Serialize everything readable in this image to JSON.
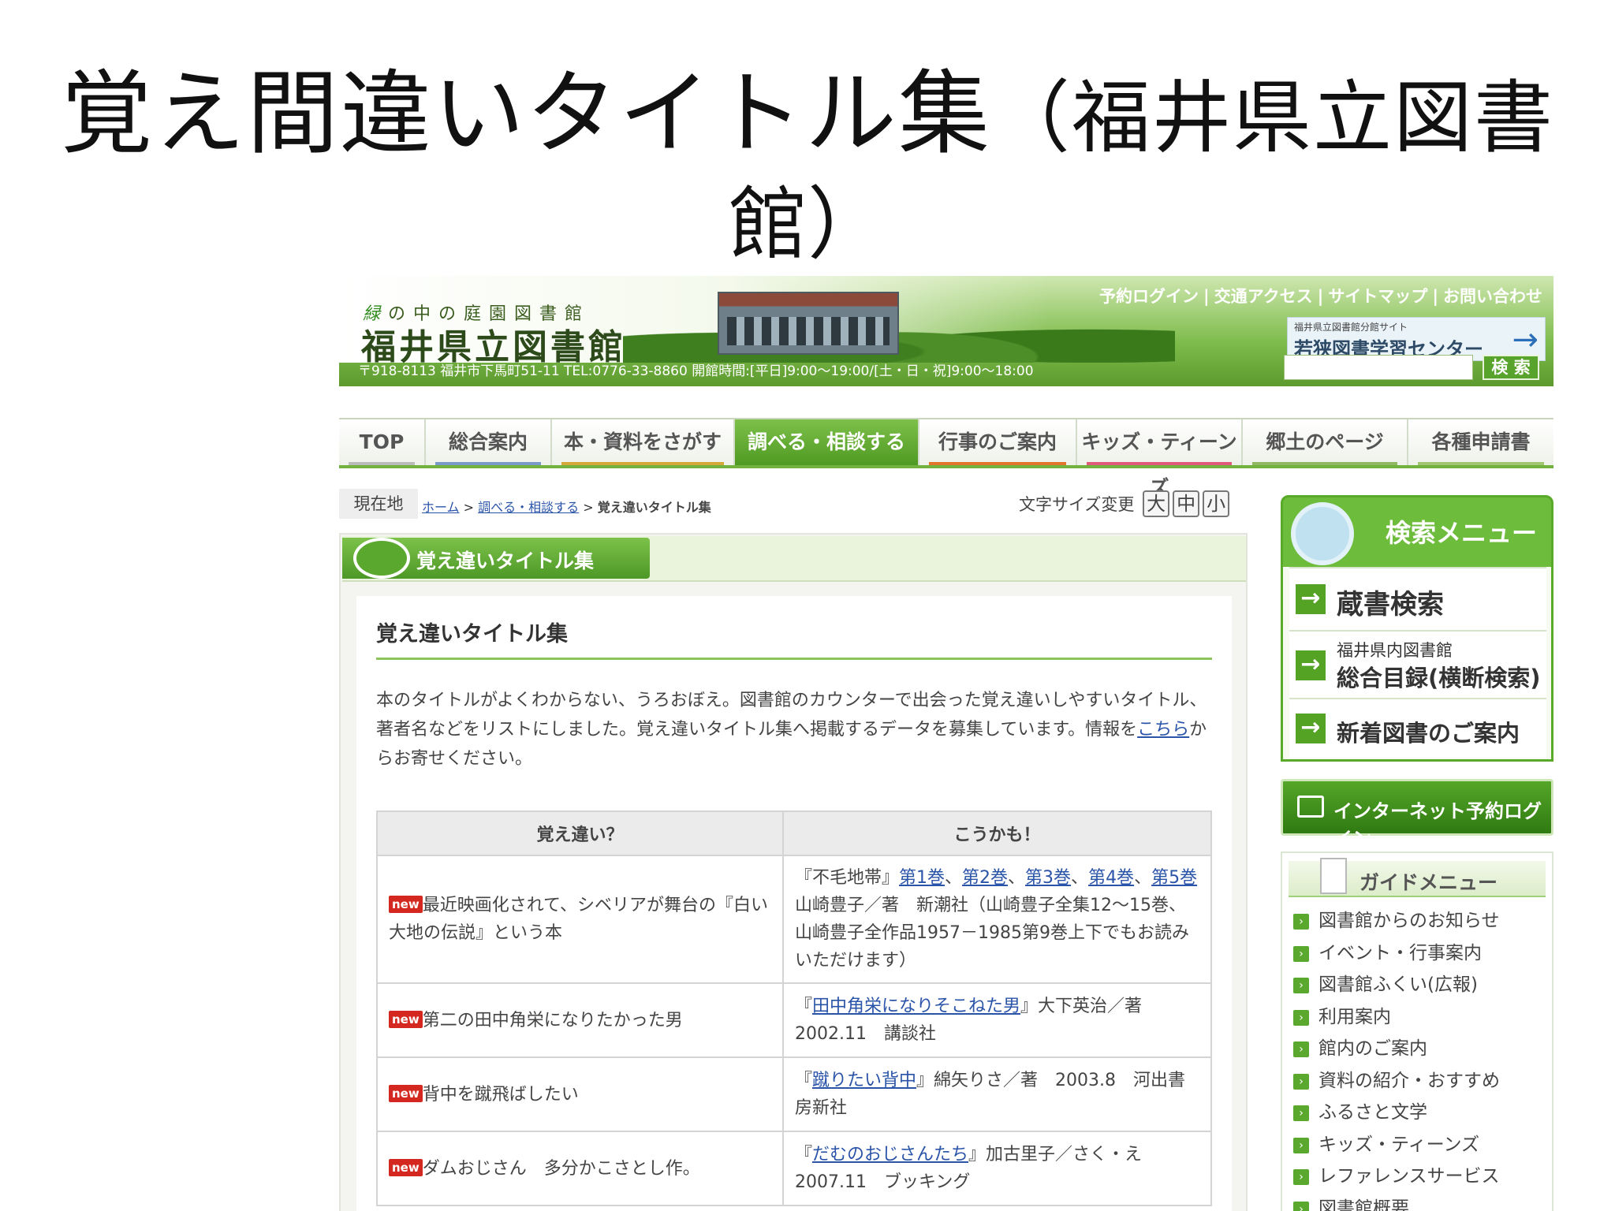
{
  "slide": {
    "title_main": "覚え間違いタイトル集",
    "title_paren": "（福井県立図書",
    "title_line2": "館）"
  },
  "site": {
    "tagline_first": "緑",
    "tagline_rest": "の中の庭園図書館",
    "name": "福井県立図書館",
    "address": "〒918-8113  福井市下馬町51-11  TEL:0776-33-8860 開館時間:[平日]9:00〜19:00/[土・日・祝]9:00〜18:00",
    "toplinks": [
      "予約ログイン",
      "交通アクセス",
      "サイトマップ",
      "お問い合わせ"
    ],
    "bunkan_small": "福井県立図書館分館サイト",
    "bunkan_name": "若狭図書学習センター",
    "search_button": "検 索",
    "search_value": ""
  },
  "nav": [
    "TOP",
    "総合案内",
    "本・資料をさがす",
    "調べる・相談する",
    "行事のご案内",
    "キッズ・ティーンズ",
    "郷土のページ",
    "各種申請書"
  ],
  "breadcrumb": {
    "label": "現在地",
    "home": "ホーム",
    "parent": "調べる・相談する",
    "current": "覚え違いタイトル集"
  },
  "fontsize": {
    "label": "文字サイズ変更",
    "large": "大",
    "medium": "中",
    "small": "小"
  },
  "content": {
    "banner_title": "覚え違いタイトル集",
    "heading": "覚え違いタイトル集",
    "intro": "本のタイトルがよくわからない、うろおぼえ。図書館のカウンターで出会った覚え違いしやすいタイトル、著者名などをリストにしました。覚え違いタイトル集へ掲載するデータを募集しています。情報を",
    "intro_link": "こちら",
    "intro_tail": "からお寄せください。",
    "badge": "new",
    "col_wrong": "覚え違い？",
    "col_right": "こうかも！",
    "rows": [
      {
        "wrong": "最近映画化されて、シベリアが舞台の『白い大地の伝説』という本",
        "answer_pre": "『不毛地帯』",
        "answer_links": [
          "第1巻",
          "第2巻",
          "第3巻",
          "第4巻",
          "第5巻"
        ],
        "answer_post": "山崎豊子／著　新潮社（山崎豊子全集12〜15巻、山崎豊子全作品1957－1985第9巻上下でもお読みいただけます）"
      },
      {
        "wrong": "第二の田中角栄になりたかった男",
        "answer_pre": "『",
        "answer_link": "田中角栄になりそこねた男",
        "answer_post": "』大下英治／著　2002.11　講談社"
      },
      {
        "wrong": "背中を蹴飛ばしたい",
        "answer_pre": "『",
        "answer_link": "蹴りたい背中",
        "answer_post": "』綿矢りさ／著　2003.8　河出書房新社"
      },
      {
        "wrong": "ダムおじさん　多分かこさとし作。",
        "answer_pre": "『",
        "answer_link": "だむのおじさんたち",
        "answer_post": "』加古里子／さく・え　2007.11　ブッキング"
      }
    ]
  },
  "sidebar": {
    "search_menu_title": "検索メニュー",
    "item1": "蔵書検索",
    "item2_small": "福井県内図書館",
    "item2_main": "総合目録(横断検索)",
    "item3": "新着図書のご案内",
    "internet_login": "インターネット予約ログイン",
    "guide_title": "ガイドメニュー",
    "guide_items": [
      "図書館からのお知らせ",
      "イベント・行事案内",
      "図書館ふくい(広報)",
      "利用案内",
      "館内のご案内",
      "資料の紹介・おすすめ",
      "ふるさと文学",
      "キッズ・ティーンズ",
      "レファレンスサービス",
      "図書館概要"
    ]
  },
  "colors": {
    "brand_green": "#5aa82e",
    "link_blue": "#2a54a8",
    "new_red": "#d4271f"
  }
}
